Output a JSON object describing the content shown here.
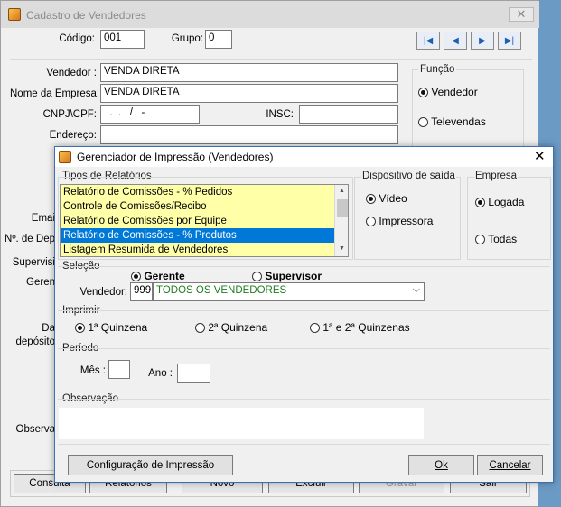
{
  "back_window": {
    "title": "Cadastro de Vendedores",
    "codigo": {
      "label": "Código:",
      "value": "001"
    },
    "grupo": {
      "label": "Grupo:",
      "value": "0"
    },
    "vendedor": {
      "label": "Vendedor :",
      "value": "VENDA DIRETA"
    },
    "nome_empresa": {
      "label": "Nome da Empresa:",
      "value": "VENDA DIRETA"
    },
    "cnpj": {
      "label": "CNPJ\\CPF:",
      "value": "  .  .   /   -"
    },
    "insc": {
      "label": "INSC:",
      "value": ""
    },
    "endereco": {
      "label": "Endereço:",
      "value": ""
    },
    "funcao": {
      "title": "Função",
      "vendedor": "Vendedor",
      "televendas": "Televendas"
    },
    "partial_labels": {
      "email": "Emai",
      "n_dep": "Nº. de Dep",
      "supervisor": "Supervisi",
      "gerente": "Geren",
      "data": "Da",
      "deposito": "depósito",
      "obs": "Observa"
    },
    "bottom_buttons": {
      "consulta": "Consulta",
      "relatorios": "Relatórios",
      "novo": "Novo",
      "excluir": "Excluir",
      "gravar": "Gravar",
      "sair": "Sair"
    }
  },
  "dialog": {
    "title": "Gerenciador de Impressão (Vendedores)",
    "tipos": {
      "title": "Tipos de Relatórios",
      "items": [
        "Relatório de Comissões - % Pedidos",
        "Controle de Comissões/Recibo",
        "Relatório de Comissões por Equipe",
        "Relatório de Comissões - % Produtos",
        "Listagem Resumida de Vendedores"
      ],
      "selected_index": 3
    },
    "dispositivo": {
      "title": "Dispositivo de saída",
      "video": "Vídeo",
      "impressora": "Impressora"
    },
    "empresa": {
      "title": "Empresa",
      "logada": "Logada",
      "todas": "Todas"
    },
    "selecao": {
      "title": "Seleção",
      "gerente": "Gerente",
      "supervisor": "Supervisor",
      "vendedor_label": "Vendedor:",
      "vendedor_code": "999",
      "vendedor_name": "TODOS OS VENDEDORES"
    },
    "imprimir": {
      "title": "Imprimir",
      "q1": "1ª Quinzena",
      "q2": "2ª Quinzena",
      "q12": "1ª e 2ª Quinzenas"
    },
    "periodo": {
      "title": "Período",
      "mes_label": "Mês :",
      "mes_value": "",
      "ano_label": "Ano :",
      "ano_value": ""
    },
    "observacao": {
      "title": "Observação",
      "value": ""
    },
    "buttons": {
      "config": "Configuração de Impressão",
      "ok": "Ok",
      "cancelar": "Cancelar"
    }
  },
  "colors": {
    "accent": "#0078d7",
    "list_bg": "#ffffa8",
    "vendedor_name_text": "#1e7d1e",
    "nav_icon": "#1a5fb4"
  }
}
